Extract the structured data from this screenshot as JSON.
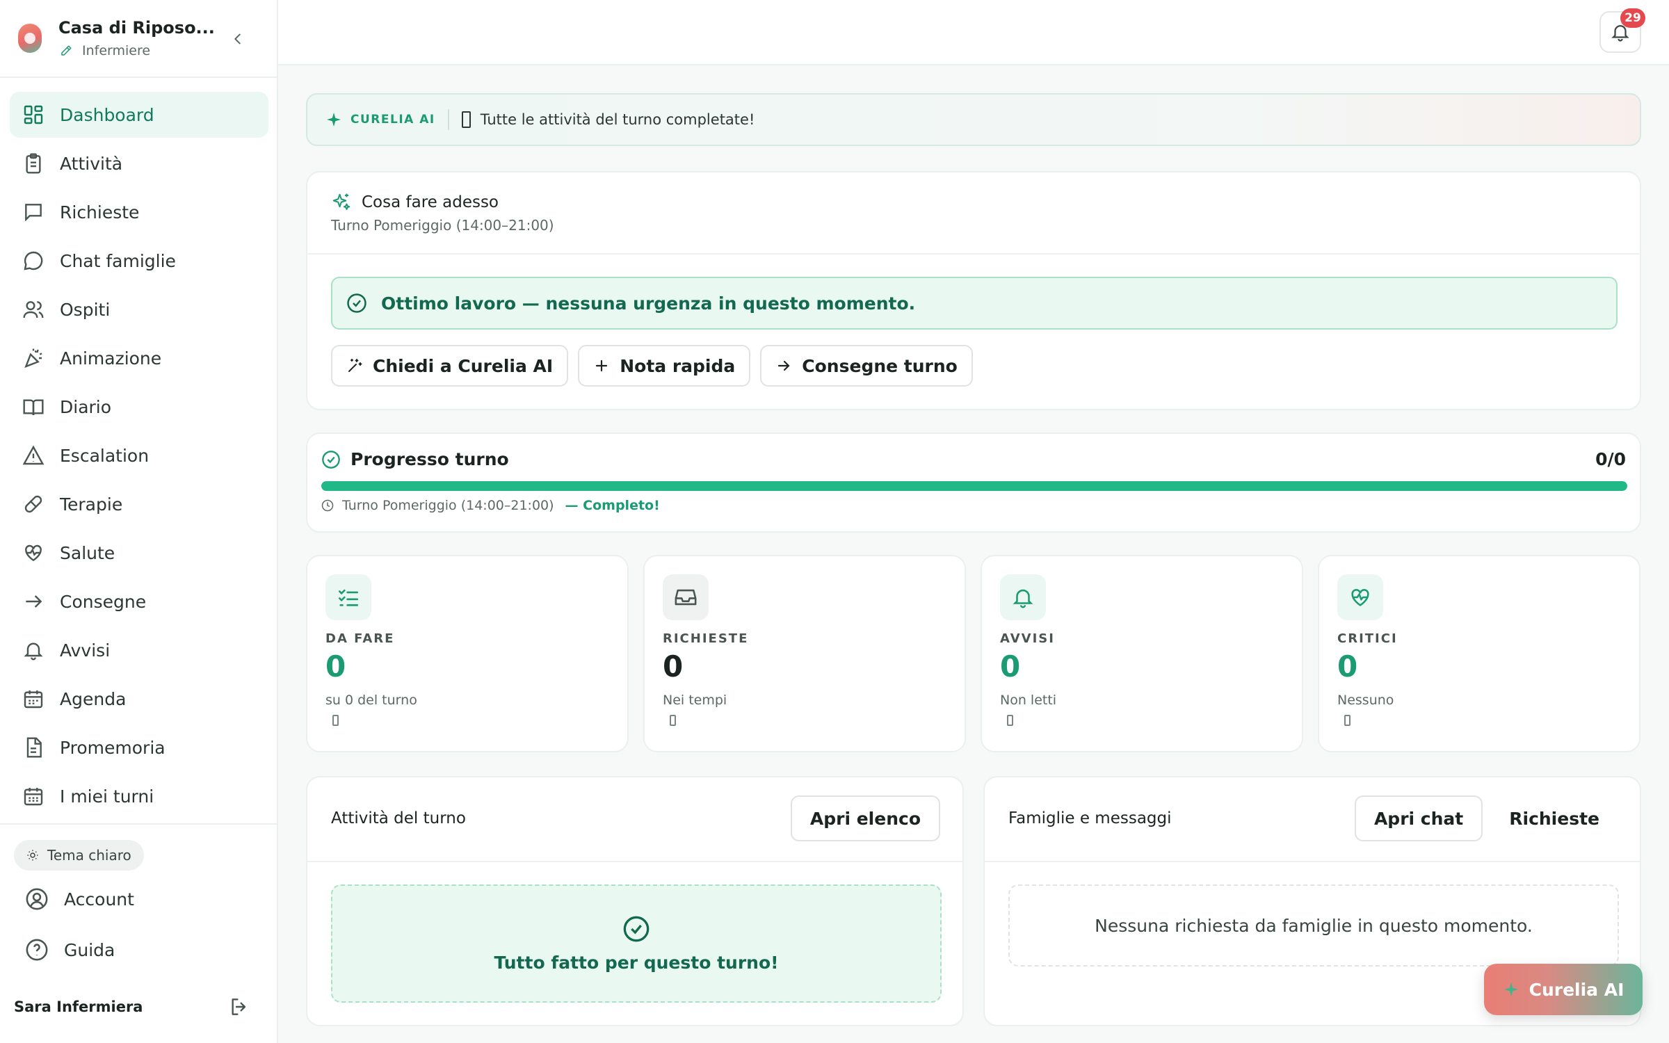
{
  "brand": {
    "title": "Casa di Riposo...",
    "role": "Infermiere"
  },
  "sidebar": {
    "items": [
      {
        "label": "Dashboard",
        "icon": "dashboard-icon",
        "active": true
      },
      {
        "label": "Attività",
        "icon": "clipboard-icon"
      },
      {
        "label": "Richieste",
        "icon": "message-square-icon"
      },
      {
        "label": "Chat famiglie",
        "icon": "chat-bubble-icon"
      },
      {
        "label": "Ospiti",
        "icon": "users-icon"
      },
      {
        "label": "Animazione",
        "icon": "party-popper-icon"
      },
      {
        "label": "Diario",
        "icon": "book-icon"
      },
      {
        "label": "Escalation",
        "icon": "alert-triangle-icon"
      },
      {
        "label": "Terapie",
        "icon": "pill-icon"
      },
      {
        "label": "Salute",
        "icon": "heart-pulse-icon"
      },
      {
        "label": "Consegne",
        "icon": "arrow-right-icon"
      },
      {
        "label": "Avvisi",
        "icon": "bell-icon"
      },
      {
        "label": "Agenda",
        "icon": "calendar-icon"
      },
      {
        "label": "Promemoria",
        "icon": "file-text-icon"
      },
      {
        "label": "I miei turni",
        "icon": "calendar-days-icon"
      }
    ],
    "theme_label": "Tema chiaro",
    "account_label": "Account",
    "guide_label": "Guida",
    "user_name": "Sara Infermiera"
  },
  "topbar": {
    "notifications_count": "29"
  },
  "ai_banner": {
    "tag": "CURELIA AI",
    "message": "Tutte le attività del turno completate!"
  },
  "todo": {
    "title": "Cosa fare adesso",
    "subtitle": "Turno Pomeriggio (14:00–21:00)",
    "ok_message": "Ottimo lavoro — nessuna urgenza in questo momento.",
    "actions": {
      "ask_ai": "Chiedi a Curelia AI",
      "quick_note": "Nota rapida",
      "handover": "Consegne turno"
    }
  },
  "progress": {
    "title": "Progresso turno",
    "count": "0/0",
    "fraction": 1.0,
    "shift": "Turno Pomeriggio (14:00–21:00)",
    "status": "— Completo!"
  },
  "stats": [
    {
      "label": "DA FARE",
      "value": "0",
      "sub": "su 0 del turno",
      "color": "#1a9b72",
      "icon_bg": "#eaf7f2",
      "icon": "list-checks-icon"
    },
    {
      "label": "RICHIESTE",
      "value": "0",
      "sub": "Nei tempi",
      "color": "#1c2421",
      "icon_bg": "#f0f2f1",
      "icon": "inbox-icon"
    },
    {
      "label": "AVVISI",
      "value": "0",
      "sub": "Non letti",
      "color": "#1a9b72",
      "icon_bg": "#eaf7f2",
      "icon": "bell-icon"
    },
    {
      "label": "CRITICI",
      "value": "0",
      "sub": "Nessuno",
      "color": "#1a9b72",
      "icon_bg": "#eaf7f2",
      "icon": "heart-pulse-icon"
    }
  ],
  "tasks_panel": {
    "title": "Attività del turno",
    "open_list": "Apri elenco",
    "done_message": "Tutto fatto per questo turno!"
  },
  "families_panel": {
    "title": "Famiglie e messaggi",
    "open_chat": "Apri chat",
    "requests": "Richieste",
    "empty_message": "Nessuna richiesta da famiglie in questo momento."
  },
  "fab": {
    "label": "Curelia AI"
  },
  "colors": {
    "accent": "#1a9b72",
    "accent_dark": "#13694f",
    "badge": "#e5484d"
  }
}
